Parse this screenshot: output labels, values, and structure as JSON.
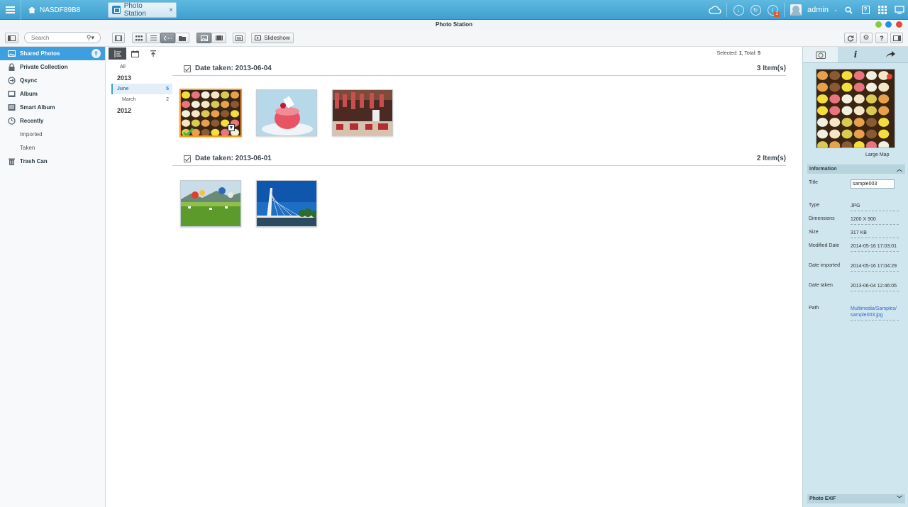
{
  "topbar": {
    "nas_name": "NASDF89B8",
    "tab_label": "Photo Station",
    "tab_close": "×",
    "notification_count": "1",
    "user": "admin"
  },
  "window": {
    "title": "Photo Station"
  },
  "toolbar": {
    "search_placeholder": "Search",
    "slideshow_label": "Slideshow"
  },
  "sidebar": {
    "items": [
      {
        "label": "Shared Photos",
        "icon": "shared-photos-icon"
      },
      {
        "label": "Private Collection",
        "icon": "lock-icon"
      },
      {
        "label": "Qsync",
        "icon": "sync-icon"
      },
      {
        "label": "Album",
        "icon": "album-icon"
      },
      {
        "label": "Smart Album",
        "icon": "smart-album-icon"
      },
      {
        "label": "Recently",
        "icon": "clock-icon"
      },
      {
        "label": "Imported",
        "icon": ""
      },
      {
        "label": "Taken",
        "icon": ""
      },
      {
        "label": "Trash Can",
        "icon": "trash-icon"
      }
    ]
  },
  "timeline": {
    "all": "All",
    "year1": "2013",
    "months": [
      {
        "name": "June",
        "count": "5"
      },
      {
        "name": "March",
        "count": "2"
      }
    ],
    "year2": "2012"
  },
  "main": {
    "status_selected_label": "Selected:",
    "status_selected": "1",
    "status_total_label": ", Total:",
    "status_total": "5",
    "groups": [
      {
        "title": "Date taken: 2013-06-04",
        "count": "3 Item(s)"
      },
      {
        "title": "Date taken: 2013-06-01",
        "count": "2 Item(s)"
      }
    ]
  },
  "info_panel": {
    "preview_caption": "Large Map",
    "section_information": "Information",
    "section_exif": "Photo EXIF",
    "fields": [
      {
        "key": "Title",
        "value": "sample003"
      },
      {
        "key": "Type",
        "value": "JPG"
      },
      {
        "key": "Dimensions",
        "value": "1200 X 900"
      },
      {
        "key": "Size",
        "value": "317 KB"
      },
      {
        "key": "Modified Date",
        "value": "2014-05-16 17:03:01"
      },
      {
        "key": "Date imported",
        "value": "2014-05-16 17:04:29"
      },
      {
        "key": "Date taken",
        "value": "2013-06-04 12:46:05"
      },
      {
        "key": "Path",
        "value": "Multimedia/Samples/sample003.jpg"
      }
    ]
  },
  "colors": {
    "topbar": "#4aaad6",
    "accent": "#3d9fe0",
    "selection": "#f39b1d",
    "right_panel": "#cfe6ee"
  }
}
